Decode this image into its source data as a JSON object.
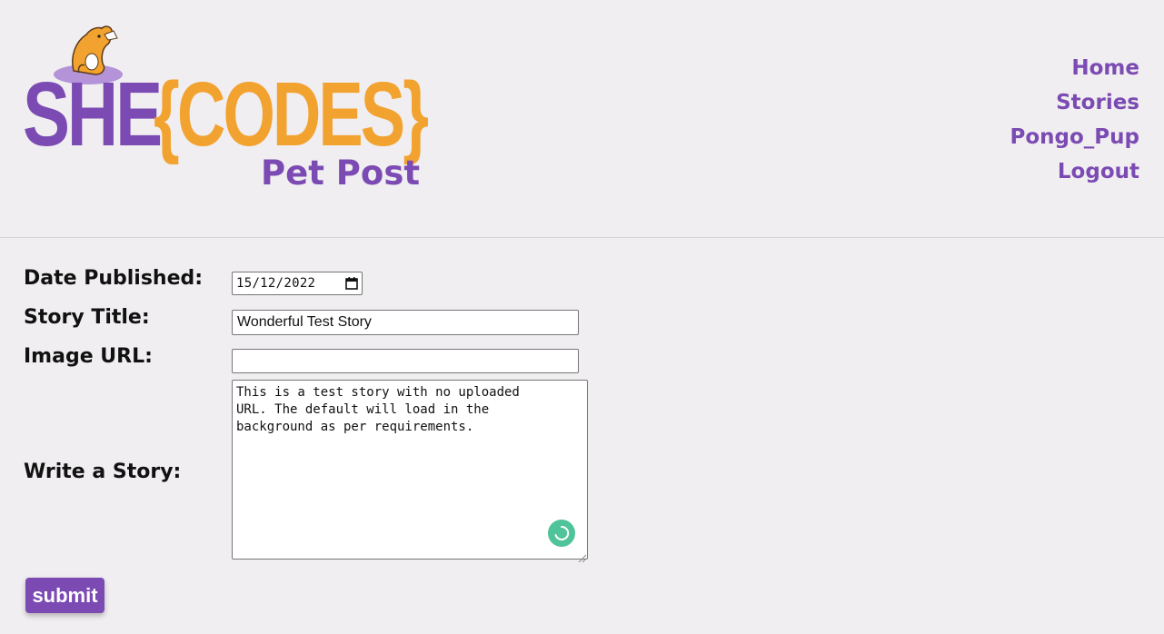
{
  "logo": {
    "brand_left": "SHE",
    "brand_right": "{CODES}",
    "subtitle": "Pet Post",
    "colors": {
      "purple": "#7b4bb3",
      "orange": "#f2a22f",
      "lavender": "#b493d9"
    },
    "mascot_icon": "dog-mascot-icon"
  },
  "nav": {
    "items": [
      {
        "label": "Home"
      },
      {
        "label": "Stories"
      },
      {
        "label": "Pongo_Pup"
      },
      {
        "label": "Logout"
      }
    ]
  },
  "form": {
    "date": {
      "label": "Date Published:",
      "value": "15/12/2022",
      "icon": "calendar-icon"
    },
    "title": {
      "label": "Story Title:",
      "value": "Wonderful Test Story"
    },
    "image_url": {
      "label": "Image URL:",
      "value": ""
    },
    "story": {
      "label": "Write a Story:",
      "value": "This is a test story with no uploaded\nURL. The default will load in the\nbackground as per requirements."
    },
    "submit_label": "submit"
  },
  "grammar_badge": {
    "icon": "grammar-assistant-icon",
    "color": "#4fc39a"
  },
  "colors": {
    "accent": "#7b4bb3",
    "background": "#f0eef0"
  }
}
